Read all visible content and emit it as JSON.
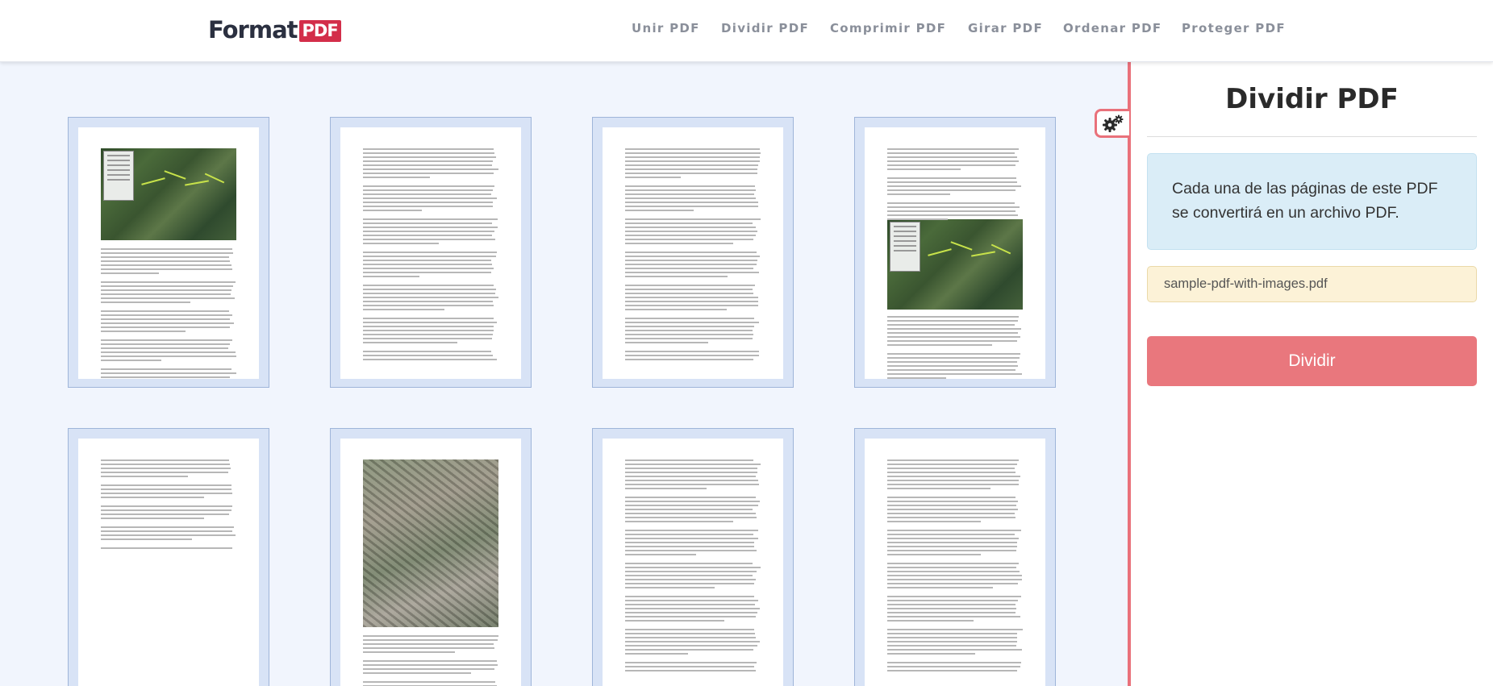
{
  "header": {
    "logo": {
      "word": "Format",
      "badge": "PDF",
      "badge_color": "#d32e4a",
      "word_color": "#2b3040"
    },
    "nav": [
      {
        "label": "Unir PDF"
      },
      {
        "label": "Dividir PDF"
      },
      {
        "label": "Comprimir PDF"
      },
      {
        "label": "Girar PDF"
      },
      {
        "label": "Ordenar PDF"
      },
      {
        "label": "Proteger PDF"
      }
    ]
  },
  "pages": [
    {
      "kind": "map-top"
    },
    {
      "kind": "text"
    },
    {
      "kind": "text"
    },
    {
      "kind": "map-middle"
    },
    {
      "kind": "short-text"
    },
    {
      "kind": "aerial"
    },
    {
      "kind": "text"
    },
    {
      "kind": "text"
    }
  ],
  "panel": {
    "title": "Dividir PDF",
    "info_text": "Cada una de las páginas de este PDF se convertirá en un archivo PDF.",
    "filename": "sample-pdf-with-images.pdf",
    "action_button": "Dividir",
    "settings_icon": "gears-icon",
    "accent_color": "#e9717b"
  }
}
